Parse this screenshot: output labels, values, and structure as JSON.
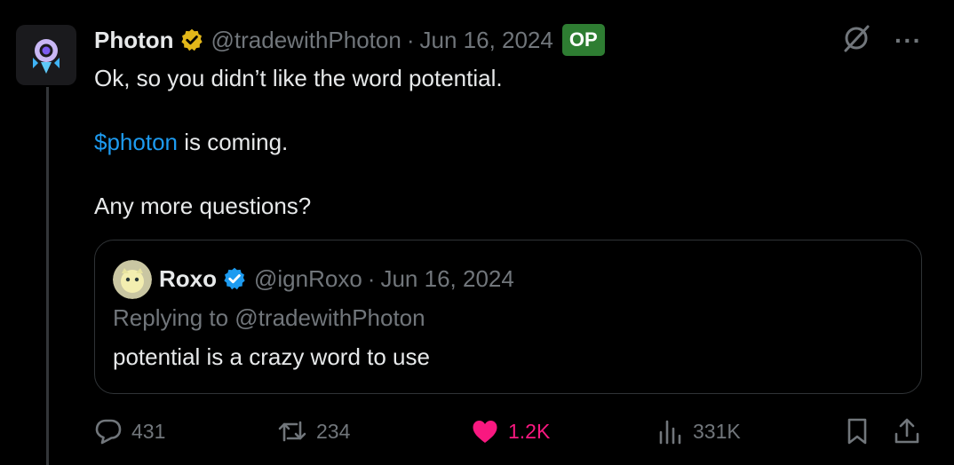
{
  "post": {
    "author_name": "Photon",
    "handle": "@tradewithPhoton",
    "separator": "·",
    "date": "Jun 16, 2024",
    "op_badge": "OP",
    "text_line1": "Ok, so you didn’t like the word potential.",
    "cashtag": "$photon",
    "text_line2_rest": " is coming.",
    "text_line3": "Any more questions?"
  },
  "quote": {
    "author_name": "Roxo",
    "handle": "@ignRoxo",
    "separator": "·",
    "date": "Jun 16, 2024",
    "replying_to": "Replying to @tradewithPhoton",
    "text": "potential is a crazy word to use"
  },
  "actions": {
    "replies": "431",
    "reposts": "234",
    "likes": "1.2K",
    "views": "331K"
  },
  "colors": {
    "background": "#000000",
    "text": "#e7e9ea",
    "muted": "#71767b",
    "link": "#1d9bf0",
    "like": "#f91880",
    "op_badge": "#2e7d32",
    "verified_gold": "#e2b719",
    "verified_blue": "#1d9bf0",
    "border": "#2f3336"
  },
  "icons": [
    "photon-logo-icon",
    "verified-gold-icon",
    "grok-icon",
    "more-icon",
    "verified-blue-icon",
    "reply-icon",
    "repost-icon",
    "like-icon",
    "views-icon",
    "bookmark-icon",
    "share-icon"
  ]
}
